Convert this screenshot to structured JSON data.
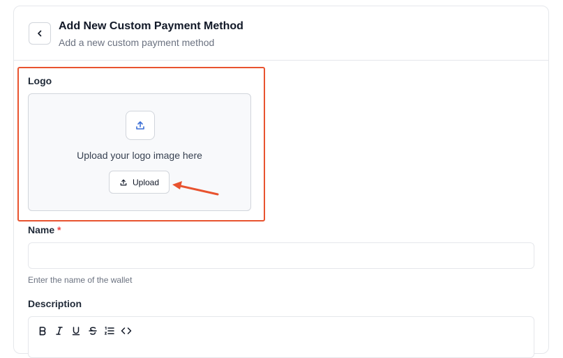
{
  "header": {
    "title": "Add New Custom Payment Method",
    "subtitle": "Add a new custom payment method"
  },
  "logo": {
    "label": "Logo",
    "drop_text": "Upload your logo image here",
    "upload_label": "Upload"
  },
  "name": {
    "label": "Name",
    "required_mark": "*",
    "value": "",
    "help": "Enter the name of the wallet"
  },
  "description": {
    "label": "Description",
    "toolbar": [
      "bold-icon",
      "italic-icon",
      "underline-icon",
      "strikethrough-icon",
      "ordered-list-icon",
      "code-icon"
    ]
  },
  "colors": {
    "highlight": "#e8532f",
    "upload_accent": "#3b6fd6",
    "required": "#ef4444"
  }
}
